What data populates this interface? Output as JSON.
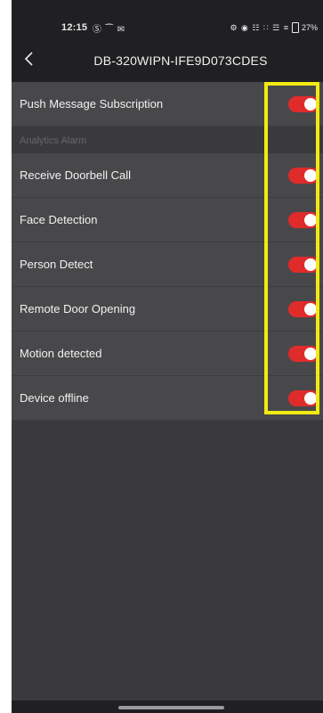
{
  "status_bar": {
    "time": "12:15",
    "left_icons": "Ⓢ ⁀ ✉",
    "right_icons": "⚙ ◉ ☷ ∷ ☲ ≡",
    "battery": "27%"
  },
  "header": {
    "title": "DB-320WIPN-IFE9D073CDES",
    "back_icon": "chevron-left-icon"
  },
  "settings": {
    "push": {
      "label": "Push Message Subscription",
      "enabled": true
    },
    "section_title": "Analytics Alarm",
    "items": [
      {
        "label": "Receive Doorbell Call",
        "enabled": true
      },
      {
        "label": "Face Detection",
        "enabled": true
      },
      {
        "label": "Person Detect",
        "enabled": true
      },
      {
        "label": "Remote Door Opening",
        "enabled": true
      },
      {
        "label": "Motion detected",
        "enabled": true
      },
      {
        "label": "Device offline",
        "enabled": true
      }
    ]
  },
  "colors": {
    "toggle_on": "#e02b2b",
    "highlight": "#f2ea12",
    "row_background": "#48484a",
    "screen_background": "#3a3a3c"
  }
}
